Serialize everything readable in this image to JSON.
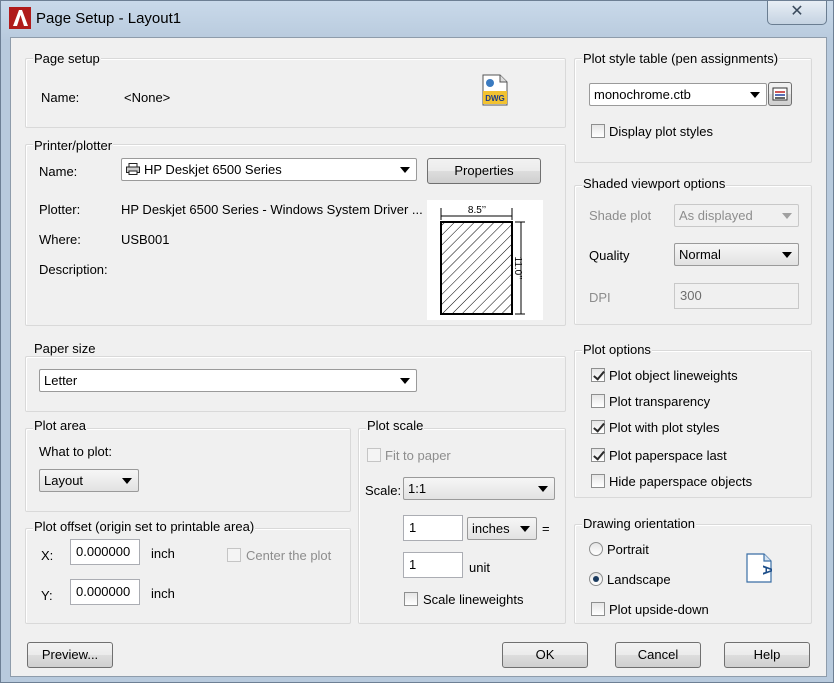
{
  "window": {
    "title": "Page Setup - Layout1"
  },
  "page_setup": {
    "group_label": "Page setup",
    "name_label": "Name:",
    "name_value": "<None>",
    "dwg_icon_text": "DWG"
  },
  "printer": {
    "group_label": "Printer/plotter",
    "name_label": "Name:",
    "name_value": "HP Deskjet 6500 Series",
    "properties_label": "Properties",
    "plotter_label": "Plotter:",
    "plotter_value": "HP Deskjet 6500 Series - Windows System Driver ...",
    "where_label": "Where:",
    "where_value": "USB001",
    "description_label": "Description:",
    "paper_width": "8.5’’",
    "paper_height": "11.0’’"
  },
  "paper_size": {
    "group_label": "Paper size",
    "value": "Letter"
  },
  "plot_area": {
    "group_label": "Plot area",
    "what_label": "What to plot:",
    "value": "Layout"
  },
  "plot_offset": {
    "group_label": "Plot offset (origin set to printable area)",
    "x_label": "X:",
    "x_value": "0.000000",
    "x_unit": "inch",
    "y_label": "Y:",
    "y_value": "0.000000",
    "y_unit": "inch",
    "center_label": "Center the plot"
  },
  "plot_scale": {
    "group_label": "Plot scale",
    "fit_label": "Fit to paper",
    "scale_label": "Scale:",
    "scale_value": "1:1",
    "top_value": "1",
    "unit_value": "inches",
    "equals": "=",
    "bottom_value": "1",
    "bottom_unit": "unit",
    "lineweights_label": "Scale lineweights"
  },
  "plot_style": {
    "group_label": "Plot style table (pen assignments)",
    "value": "monochrome.ctb",
    "display_label": "Display plot styles"
  },
  "shaded": {
    "group_label": "Shaded viewport options",
    "shade_label": "Shade plot",
    "shade_value": "As displayed",
    "quality_label": "Quality",
    "quality_value": "Normal",
    "dpi_label": "DPI",
    "dpi_value": "300"
  },
  "plot_options": {
    "group_label": "Plot options",
    "items": [
      {
        "label": "Plot object lineweights",
        "checked": true
      },
      {
        "label": "Plot transparency",
        "checked": false
      },
      {
        "label": "Plot with plot styles",
        "checked": true
      },
      {
        "label": "Plot paperspace last",
        "checked": true
      },
      {
        "label": "Hide paperspace objects",
        "checked": false
      }
    ]
  },
  "orientation": {
    "group_label": "Drawing orientation",
    "portrait_label": "Portrait",
    "landscape_label": "Landscape",
    "upside_label": "Plot upside-down",
    "icon_letter": "A"
  },
  "buttons": {
    "preview": "Preview...",
    "ok": "OK",
    "cancel": "Cancel",
    "help": "Help"
  }
}
